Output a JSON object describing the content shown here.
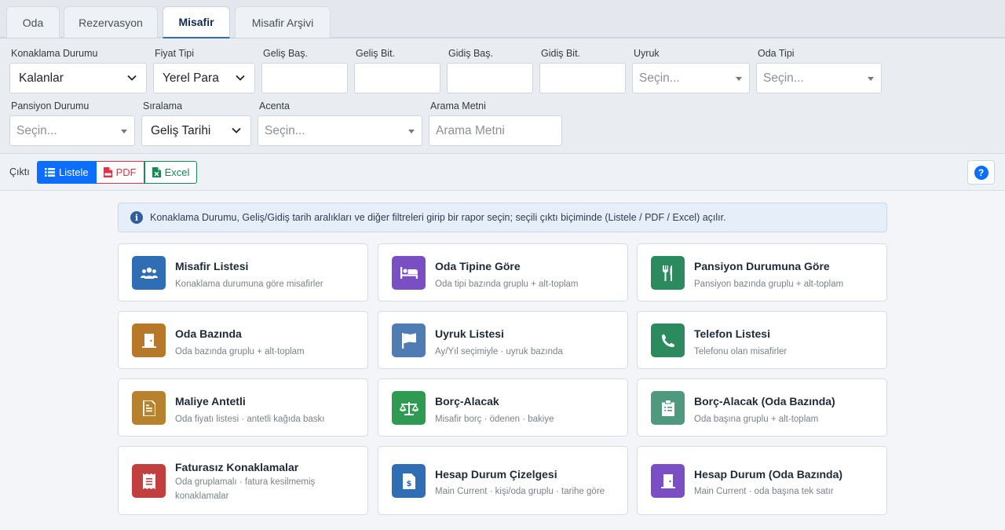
{
  "tabs": [
    "Oda",
    "Rezervasyon",
    "Misafir",
    "Misafir Arşivi"
  ],
  "filters": {
    "konaklama_durumu": {
      "label": "Konaklama Durumu",
      "value": "Kalanlar"
    },
    "fiyat_tipi": {
      "label": "Fiyat Tipi",
      "value": "Yerel Para"
    },
    "gelis_bas": {
      "label": "Geliş Baş.",
      "value": ""
    },
    "gelis_bit": {
      "label": "Geliş Bit.",
      "value": ""
    },
    "gidis_bas": {
      "label": "Gidiş Baş.",
      "value": ""
    },
    "gidis_bit": {
      "label": "Gidiş Bit.",
      "value": ""
    },
    "uyruk": {
      "label": "Uyruk",
      "placeholder": "Seçin..."
    },
    "oda_tipi": {
      "label": "Oda Tipi",
      "placeholder": "Seçin..."
    },
    "pansiyon_durumu": {
      "label": "Pansiyon Durumu",
      "placeholder": "Seçin..."
    },
    "siralama": {
      "label": "Sıralama",
      "value": "Geliş Tarihi"
    },
    "acenta": {
      "label": "Acenta",
      "placeholder": "Seçin..."
    },
    "arama_metni": {
      "label": "Arama Metni",
      "placeholder": "Arama Metni"
    }
  },
  "output": {
    "label": "Çıktı",
    "list": "Listele",
    "pdf": "PDF",
    "excel": "Excel",
    "help": "?"
  },
  "info": "Konaklama Durumu, Geliş/Gidiş tarih aralıkları ve diğer filtreleri girip bir rapor seçin; seçili çıktı biçiminde (Listele / PDF / Excel) açılır.",
  "reports": [
    {
      "title": "Misafir Listesi",
      "sub": "Konaklama durumuna göre misafirler",
      "color": "#2f6db5",
      "icon": "users-icon"
    },
    {
      "title": "Oda Tipine Göre",
      "sub": "Oda tipi bazında gruplu + alt-toplam",
      "color": "#7b4fc4",
      "icon": "bed-icon"
    },
    {
      "title": "Pansiyon Durumuna Göre",
      "sub": "Pansiyon bazında gruplu + alt-toplam",
      "color": "#2b8a5e",
      "icon": "utensils-icon"
    },
    {
      "title": "Oda Bazında",
      "sub": "Oda bazında gruplu + alt-toplam",
      "color": "#b7782a",
      "icon": "door-icon"
    },
    {
      "title": "Uyruk Listesi",
      "sub": "Ay/Yıl seçimiyle · uyruk bazında",
      "color": "#4f7db3",
      "icon": "flag-icon"
    },
    {
      "title": "Telefon Listesi",
      "sub": "Telefonu olan misafirler",
      "color": "#2b8a5e",
      "icon": "phone-icon"
    },
    {
      "title": "Maliye Antetli",
      "sub": "Oda fiyatı listesi · antetli kağıda baskı",
      "color": "#b7812e",
      "icon": "document-icon"
    },
    {
      "title": "Borç-Alacak",
      "sub": "Misafir borç · ödenen · bakiye",
      "color": "#2f9a52",
      "icon": "scale-icon"
    },
    {
      "title": "Borç-Alacak (Oda Bazında)",
      "sub": "Oda başına gruplu + alt-toplam",
      "color": "#4f9a7e",
      "icon": "clipboard-icon"
    },
    {
      "title": "Faturasız Konaklamalar",
      "sub": "Oda gruplamalı · fatura kesilmemiş konaklamalar",
      "color": "#c23f3f",
      "icon": "receipt-icon"
    },
    {
      "title": "Hesap Durum Çizelgesi",
      "sub": "Main Current · kişi/oda gruplu · tarihe göre",
      "color": "#2f6db5",
      "icon": "invoice-dollar-icon"
    },
    {
      "title": "Hesap Durum (Oda Bazında)",
      "sub": "Main Current · oda başına tek satır",
      "color": "#7b4fc4",
      "icon": "door-icon"
    }
  ]
}
